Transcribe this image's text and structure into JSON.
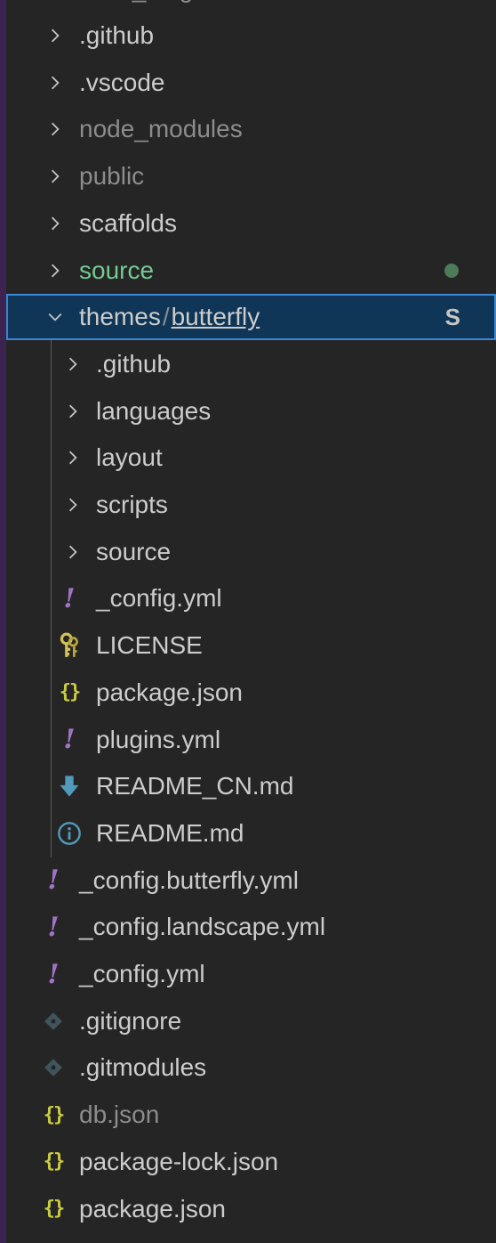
{
  "explorer": {
    "partial_top": "hexo_blog",
    "items": [
      {
        "label": ".github",
        "kind": "folder",
        "depth": 0
      },
      {
        "label": ".vscode",
        "kind": "folder",
        "depth": 0
      },
      {
        "label": "node_modules",
        "kind": "folder",
        "depth": 0,
        "dim": true
      },
      {
        "label": "public",
        "kind": "folder",
        "depth": 0,
        "dim": true
      },
      {
        "label": "scaffolds",
        "kind": "folder",
        "depth": 0
      },
      {
        "label": "source",
        "kind": "folder",
        "depth": 0,
        "status": "modified"
      },
      {
        "label": "themes",
        "label2": "butterfly",
        "separator": "/",
        "kind": "folder-open",
        "depth": 0,
        "badge": "S",
        "selected": true
      },
      {
        "label": ".github",
        "kind": "folder",
        "depth": 1
      },
      {
        "label": "languages",
        "kind": "folder",
        "depth": 1
      },
      {
        "label": "layout",
        "kind": "folder",
        "depth": 1
      },
      {
        "label": "scripts",
        "kind": "folder",
        "depth": 1
      },
      {
        "label": "source",
        "kind": "folder",
        "depth": 1
      },
      {
        "label": "_config.yml",
        "kind": "yaml",
        "depth": 1
      },
      {
        "label": "LICENSE",
        "kind": "license",
        "depth": 1
      },
      {
        "label": "package.json",
        "kind": "json",
        "depth": 1
      },
      {
        "label": "plugins.yml",
        "kind": "yaml",
        "depth": 1
      },
      {
        "label": "README_CN.md",
        "kind": "markdown-download",
        "depth": 1
      },
      {
        "label": "README.md",
        "kind": "info",
        "depth": 1
      },
      {
        "label": "_config.butterfly.yml",
        "kind": "yaml",
        "depth": 0
      },
      {
        "label": "_config.landscape.yml",
        "kind": "yaml",
        "depth": 0
      },
      {
        "label": "_config.yml",
        "kind": "yaml",
        "depth": 0
      },
      {
        "label": ".gitignore",
        "kind": "git",
        "depth": 0
      },
      {
        "label": ".gitmodules",
        "kind": "git",
        "depth": 0
      },
      {
        "label": "db.json",
        "kind": "json",
        "depth": 0,
        "dim": true
      },
      {
        "label": "package-lock.json",
        "kind": "json",
        "depth": 0
      },
      {
        "label": "package.json",
        "kind": "json",
        "depth": 0
      }
    ]
  },
  "colors": {
    "background": "#252526",
    "selected_bg": "#0f3657",
    "selected_border": "#3b87d6",
    "modified_green": "#73c991",
    "yaml_purple": "#a074c4",
    "json_yellow": "#cbcb41",
    "info_blue": "#519aba"
  }
}
